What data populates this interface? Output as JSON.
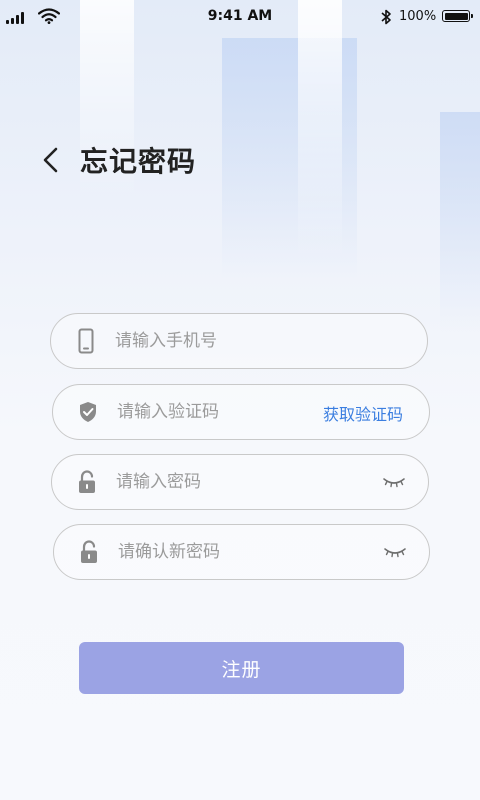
{
  "status_bar": {
    "time": "9:41 AM",
    "battery_text": "100%",
    "icons": [
      "signal-icon",
      "wifi-icon",
      "bluetooth-icon",
      "battery-icon"
    ]
  },
  "header": {
    "title": "忘记密码",
    "back_icon": "chevron-left-icon"
  },
  "form": {
    "phone": {
      "placeholder": "请输入手机号",
      "value": "",
      "icon": "phone-icon"
    },
    "code": {
      "placeholder": "请输入验证码",
      "value": "",
      "icon": "shield-check-icon",
      "action_label": "获取验证码"
    },
    "password": {
      "placeholder": "请输入密码",
      "value": "",
      "icon": "lock-icon",
      "toggle_icon": "eye-closed-icon"
    },
    "confirm_password": {
      "placeholder": "请确认新密码",
      "value": "",
      "icon": "lock-icon",
      "toggle_icon": "eye-closed-icon"
    },
    "submit_label": "注册"
  },
  "colors": {
    "accent": "#3b7ee0",
    "button": "#9ba3e4",
    "border": "#c9c9c9",
    "placeholder": "#9b9b9b",
    "title": "#222222"
  }
}
